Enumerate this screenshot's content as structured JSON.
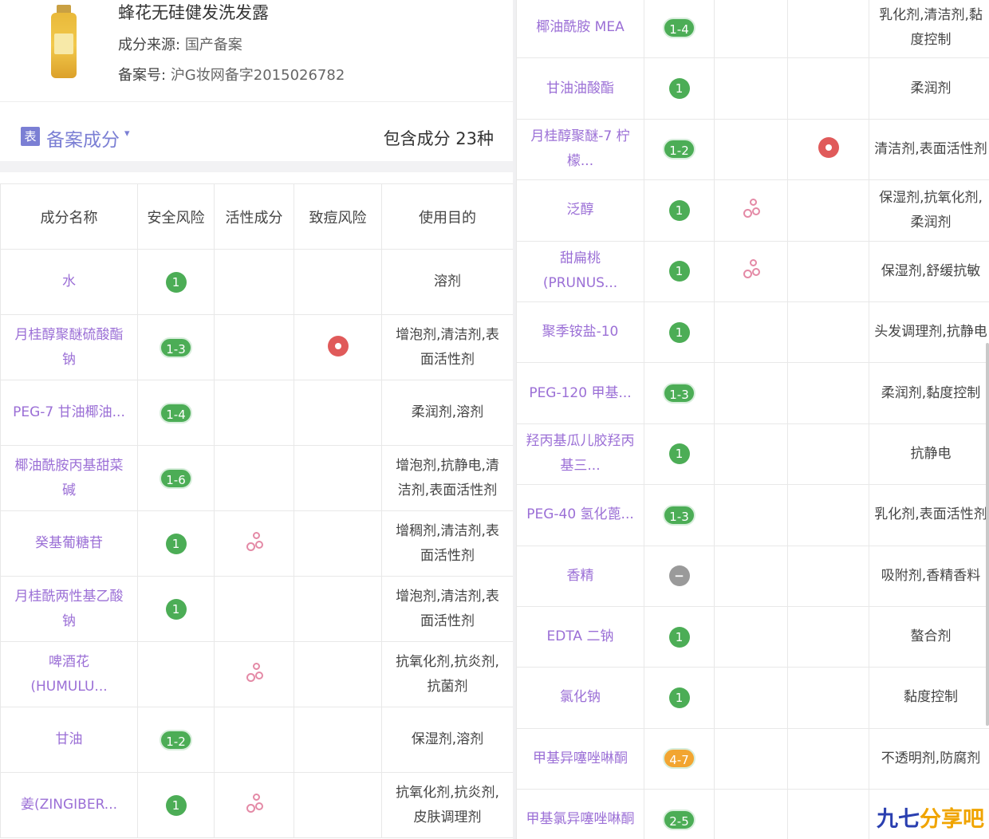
{
  "product": {
    "name": "蜂花无硅健发洗发露",
    "source_label": "成分来源:",
    "source_value": "国产备案",
    "reg_label": "备案号:",
    "reg_value": "沪G妆网备字2015026782"
  },
  "section": {
    "icon_text": "表",
    "title": "备案成分",
    "caret": "▾",
    "count_text": "包含成分 23种"
  },
  "table_headers": [
    "成分名称",
    "安全风险",
    "活性成分",
    "致痘风险",
    "使用目的"
  ],
  "ingredients_left": [
    {
      "name_lines": [
        "水"
      ],
      "risk": "1",
      "risk_color": "#4cad56",
      "active": false,
      "acne": false,
      "purpose_lines": [
        "溶剂"
      ]
    },
    {
      "name_lines": [
        "月桂醇聚醚硫酸酯",
        "钠"
      ],
      "risk": "1-3",
      "risk_color": "#4cad56",
      "active": false,
      "acne": true,
      "purpose_lines": [
        "增泡剂,清洁剂,表",
        "面活性剂"
      ]
    },
    {
      "name_lines": [
        "PEG-7 甘油椰油..."
      ],
      "risk": "1-4",
      "risk_color": "#4cad56",
      "active": false,
      "acne": false,
      "purpose_lines": [
        "柔润剂,溶剂"
      ]
    },
    {
      "name_lines": [
        "椰油酰胺丙基甜菜",
        "碱"
      ],
      "risk": "1-6",
      "risk_color": "#4cad56",
      "active": false,
      "acne": false,
      "purpose_lines": [
        "增泡剂,抗静电,清",
        "洁剂,表面活性剂"
      ]
    },
    {
      "name_lines": [
        "癸基葡糖苷"
      ],
      "risk": "1",
      "risk_color": "#4cad56",
      "active": true,
      "acne": false,
      "purpose_lines": [
        "增稠剂,清洁剂,表",
        "面活性剂"
      ]
    },
    {
      "name_lines": [
        "月桂酰两性基乙酸",
        "钠"
      ],
      "risk": "1",
      "risk_color": "#4cad56",
      "active": false,
      "acne": false,
      "purpose_lines": [
        "增泡剂,清洁剂,表",
        "面活性剂"
      ]
    },
    {
      "name_lines": [
        "啤酒花",
        "(HUMULU..."
      ],
      "risk": "",
      "risk_color": "#4cad56",
      "active": true,
      "acne": false,
      "purpose_lines": [
        "抗氧化剂,抗炎剂,",
        "抗菌剂"
      ]
    },
    {
      "name_lines": [
        "甘油"
      ],
      "risk": "1-2",
      "risk_color": "#4cad56",
      "active": false,
      "acne": false,
      "purpose_lines": [
        "保湿剂,溶剂"
      ]
    },
    {
      "name_lines": [
        "姜(ZINGIBER..."
      ],
      "risk": "1",
      "risk_color": "#4cad56",
      "active": true,
      "acne": false,
      "purpose_lines": [
        "抗氧化剂,抗炎剂,",
        "皮肤调理剂"
      ]
    }
  ],
  "ingredients_right": [
    {
      "name_lines": [
        "椰油酰胺 MEA"
      ],
      "risk": "1-4",
      "risk_color": "#4cad56",
      "active": false,
      "acne": false,
      "purpose_lines": [
        "乳化剂,清洁剂,黏",
        "度控制"
      ]
    },
    {
      "name_lines": [
        "甘油油酸酯"
      ],
      "risk": "1",
      "risk_color": "#4cad56",
      "active": false,
      "acne": false,
      "purpose_lines": [
        "柔润剂"
      ]
    },
    {
      "name_lines": [
        "月桂醇聚醚-7 柠",
        "檬..."
      ],
      "risk": "1-2",
      "risk_color": "#4cad56",
      "active": false,
      "acne": true,
      "purpose_lines": [
        "清洁剂,表面活性剂"
      ]
    },
    {
      "name_lines": [
        "泛醇"
      ],
      "risk": "1",
      "risk_color": "#4cad56",
      "active": true,
      "acne": false,
      "purpose_lines": [
        "保湿剂,抗氧化剂,",
        "柔润剂"
      ]
    },
    {
      "name_lines": [
        "甜扁桃",
        "(PRUNUS..."
      ],
      "risk": "1",
      "risk_color": "#4cad56",
      "active": true,
      "acne": false,
      "purpose_lines": [
        "保湿剂,舒缓抗敏"
      ]
    },
    {
      "name_lines": [
        "聚季铵盐-10"
      ],
      "risk": "1",
      "risk_color": "#4cad56",
      "active": false,
      "acne": false,
      "purpose_lines": [
        "头发调理剂,抗静电"
      ]
    },
    {
      "name_lines": [
        "PEG-120 甲基..."
      ],
      "risk": "1-3",
      "risk_color": "#4cad56",
      "active": false,
      "acne": false,
      "purpose_lines": [
        "柔润剂,黏度控制"
      ]
    },
    {
      "name_lines": [
        "羟丙基瓜儿胶羟丙",
        "基三..."
      ],
      "risk": "1",
      "risk_color": "#4cad56",
      "active": false,
      "acne": false,
      "purpose_lines": [
        "抗静电"
      ]
    },
    {
      "name_lines": [
        "PEG-40 氢化蓖..."
      ],
      "risk": "1-3",
      "risk_color": "#4cad56",
      "active": false,
      "acne": false,
      "purpose_lines": [
        "乳化剂,表面活性剂"
      ]
    },
    {
      "name_lines": [
        "香精"
      ],
      "risk": "−",
      "risk_color": "#9a9a9a",
      "active": false,
      "acne": false,
      "purpose_lines": [
        "吸附剂,香精香料"
      ]
    },
    {
      "name_lines": [
        "EDTA 二钠"
      ],
      "risk": "1",
      "risk_color": "#4cad56",
      "active": false,
      "acne": false,
      "purpose_lines": [
        "螯合剂"
      ]
    },
    {
      "name_lines": [
        "氯化钠"
      ],
      "risk": "1",
      "risk_color": "#4cad56",
      "active": false,
      "acne": false,
      "purpose_lines": [
        "黏度控制"
      ]
    },
    {
      "name_lines": [
        "甲基异噻唑啉酮"
      ],
      "risk": "4-7",
      "risk_color": "#f2a531",
      "active": false,
      "acne": false,
      "purpose_lines": [
        "不透明剂,防腐剂"
      ]
    },
    {
      "name_lines": [
        "甲基氯异噻唑啉酮"
      ],
      "risk": "2-5",
      "risk_color": "#4cad56",
      "active": false,
      "acne": false,
      "purpose_lines": [
        ""
      ]
    }
  ],
  "watermark": {
    "part1": "九七",
    "part2": "分享吧"
  }
}
